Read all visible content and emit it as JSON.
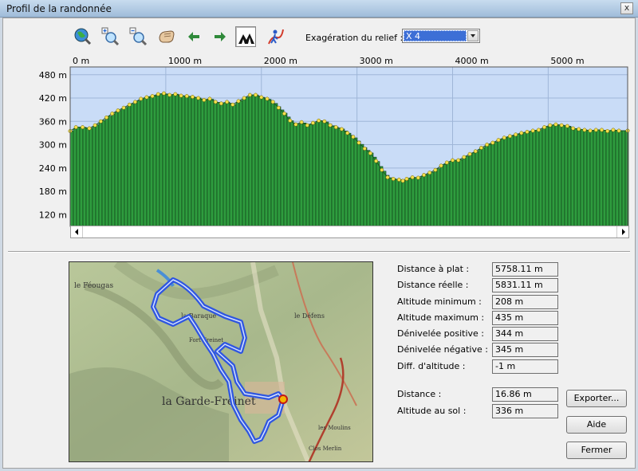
{
  "window": {
    "title": "Profil de la randonnée",
    "close_label": "x"
  },
  "toolbar": {
    "icons": [
      "globe-zoom-icon",
      "zoom-in-icon",
      "zoom-out-icon",
      "pan-hand-icon",
      "arrow-left-icon",
      "arrow-right-icon",
      "forest-profile-icon",
      "walker-route-icon"
    ],
    "exaggeration_label": "Exagération du relief :",
    "exaggeration_value": "X 4"
  },
  "profile": {
    "x_tick_labels": [
      "0 m",
      "1000 m",
      "2000 m",
      "3000 m",
      "4000 m",
      "5000 m"
    ],
    "y_tick_labels": [
      "480 m",
      "420 m",
      "360 m",
      "300 m",
      "240 m",
      "180 m",
      "120 m"
    ]
  },
  "chart_data": {
    "type": "area",
    "x_ticks": [
      0,
      1000,
      2000,
      3000,
      4000,
      5000
    ],
    "y_ticks": [
      480,
      420,
      360,
      300,
      240,
      180,
      120
    ],
    "x_range": [
      0,
      5831
    ],
    "y_range": [
      90,
      500
    ],
    "grid": true,
    "colors": {
      "fill": "#2e9c3e",
      "background": "#c9dcf7",
      "points": "#f4e04d"
    },
    "x": [
      0,
      60,
      130,
      200,
      260,
      320,
      380,
      440,
      500,
      560,
      620,
      680,
      740,
      800,
      860,
      920,
      980,
      1040,
      1100,
      1160,
      1220,
      1280,
      1340,
      1400,
      1460,
      1520,
      1580,
      1640,
      1700,
      1760,
      1820,
      1880,
      1940,
      2000,
      2060,
      2120,
      2180,
      2240,
      2300,
      2360,
      2420,
      2480,
      2540,
      2600,
      2660,
      2720,
      2780,
      2840,
      2900,
      2960,
      3020,
      3080,
      3140,
      3200,
      3260,
      3320,
      3380,
      3440,
      3480,
      3520,
      3580,
      3640,
      3700,
      3760,
      3820,
      3880,
      3940,
      4000,
      4060,
      4120,
      4180,
      4240,
      4300,
      4360,
      4420,
      4480,
      4540,
      4600,
      4660,
      4720,
      4780,
      4840,
      4900,
      4960,
      5020,
      5080,
      5140,
      5200,
      5260,
      5320,
      5380,
      5440,
      5500,
      5560,
      5620,
      5680,
      5740,
      5831
    ],
    "y": [
      335,
      345,
      345,
      342,
      350,
      360,
      370,
      380,
      388,
      395,
      403,
      410,
      418,
      422,
      425,
      430,
      432,
      428,
      430,
      426,
      425,
      423,
      420,
      415,
      418,
      410,
      406,
      410,
      403,
      412,
      420,
      428,
      428,
      422,
      418,
      410,
      395,
      380,
      362,
      352,
      358,
      350,
      356,
      362,
      360,
      350,
      345,
      340,
      330,
      320,
      305,
      290,
      278,
      258,
      235,
      216,
      212,
      210,
      207,
      212,
      216,
      215,
      222,
      228,
      235,
      246,
      254,
      260,
      260,
      268,
      276,
      283,
      292,
      300,
      305,
      312,
      318,
      322,
      326,
      330,
      333,
      336,
      338,
      345,
      350,
      352,
      350,
      348,
      342,
      340,
      338,
      336,
      338,
      338,
      335,
      338,
      336,
      336
    ]
  },
  "stats": {
    "items": [
      {
        "label": "Distance à plat :",
        "value": "5758.11 m"
      },
      {
        "label": "Distance réelle :",
        "value": "5831.11 m"
      },
      {
        "label": "Altitude minimum :",
        "value": "208 m"
      },
      {
        "label": "Altitude maximum :",
        "value": "435 m"
      },
      {
        "label": "Dénivelée positive :",
        "value": "344 m"
      },
      {
        "label": "Dénivelée négative :",
        "value": "345 m"
      },
      {
        "label": "Diff. d'altitude :",
        "value": "-1 m"
      }
    ],
    "cursor": [
      {
        "label": "Distance :",
        "value": "16.86 m"
      },
      {
        "label": "Altitude au sol :",
        "value": "336 m"
      }
    ]
  },
  "buttons": {
    "export": "Exporter...",
    "help": "Aide",
    "close": "Fermer"
  },
  "map": {
    "place_labels": [
      "le Féougas",
      "la Garde-Freinet",
      "le Défens",
      "la Baraque",
      "Fort Freinet",
      "les Moulins",
      "Clos Merlin"
    ],
    "route_color": "#2f56e0"
  }
}
